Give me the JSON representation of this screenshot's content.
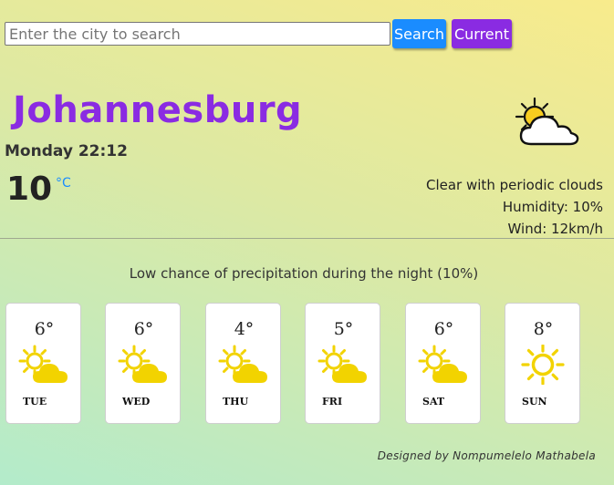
{
  "search": {
    "placeholder": "Enter the city to search",
    "value": "",
    "search_label": "Search",
    "current_label": "Current"
  },
  "weather": {
    "city": "Johannesburg",
    "datetime": "Monday 22:12",
    "temperature": "10",
    "unit": "°C",
    "description": "Clear with periodic clouds",
    "humidity": "Humidity: 10%",
    "wind": "Wind: 12km/h",
    "icon": "partly-cloudy-icon"
  },
  "summary": "Low chance of precipitation during the night (10%)",
  "forecast": [
    {
      "day": "TUE",
      "temp": "6°",
      "icon": "partly-cloudy-icon"
    },
    {
      "day": "WED",
      "temp": "6°",
      "icon": "partly-cloudy-icon"
    },
    {
      "day": "THU",
      "temp": "4°",
      "icon": "partly-cloudy-icon"
    },
    {
      "day": "FRI",
      "temp": "5°",
      "icon": "partly-cloudy-icon"
    },
    {
      "day": "SAT",
      "temp": "6°",
      "icon": "partly-cloudy-icon"
    },
    {
      "day": "SUN",
      "temp": "8°",
      "icon": "sun-icon"
    }
  ],
  "credit": "Designed by Nompumelelo Mathabela",
  "colors": {
    "accent_purple": "#8a2be2",
    "accent_blue": "#1a8cff",
    "sun_yellow": "#f2d300"
  }
}
